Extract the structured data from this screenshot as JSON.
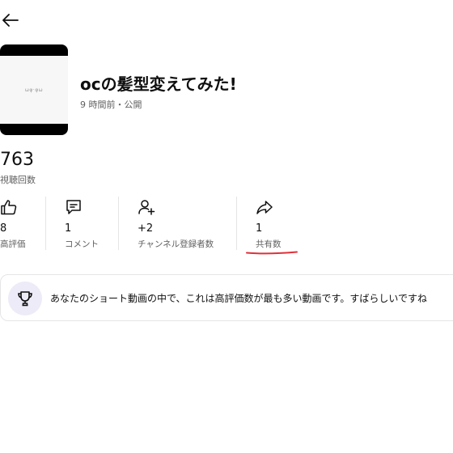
{
  "video": {
    "title": "ocの髪型変えてみた!",
    "meta": "9 時間前・公開",
    "thumbnail_text": "ωφ·φω"
  },
  "views": {
    "count": "763",
    "label": "視聴回数"
  },
  "stats": [
    {
      "icon": "thumbs-up-icon",
      "value": "8",
      "label": "高評価"
    },
    {
      "icon": "comment-icon",
      "value": "1",
      "label": "コメント"
    },
    {
      "icon": "add-subscriber-icon",
      "value": "+2",
      "label": "チャンネル登録者数"
    },
    {
      "icon": "share-icon",
      "value": "1",
      "label": "共有数"
    }
  ],
  "insight": {
    "icon": "trophy-icon",
    "text": "あなたのショート動画の中で、これは高評価数が最も多い動画です。すばらしいですね"
  },
  "colors": {
    "annotation_underline": "#e0303a",
    "trophy_bg": "#ecebf7"
  }
}
